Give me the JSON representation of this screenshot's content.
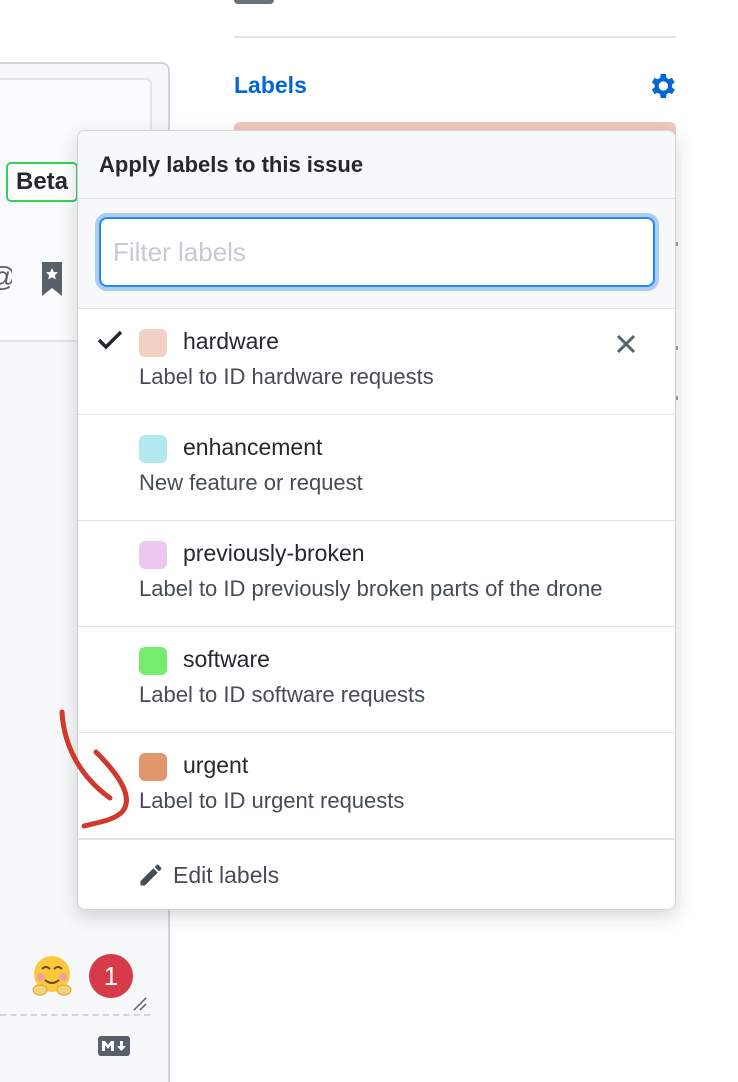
{
  "editor": {
    "beta_badge": "Beta",
    "notification_count": "1",
    "icons": [
      "mention-icon",
      "bookmark-icon",
      "hugging-face-emoji",
      "resize-handle-icon",
      "markdown-icon"
    ]
  },
  "sidebar": {
    "labels_heading": "Labels",
    "icons": [
      "gear-icon"
    ]
  },
  "dropdown": {
    "title": "Apply labels to this issue",
    "filter_placeholder": "Filter labels",
    "filter_value": "",
    "labels": [
      {
        "name": "hardware",
        "description": "Label to ID hardware requests",
        "color": "#f1d1c4",
        "selected": true
      },
      {
        "name": "enhancement",
        "description": "New feature or request",
        "color": "#b3e8ee",
        "selected": false
      },
      {
        "name": "previously-broken",
        "description": "Label to ID previously broken parts of the drone",
        "color": "#ecc8f1",
        "selected": false
      },
      {
        "name": "software",
        "description": "Label to ID software requests",
        "color": "#74ec6c",
        "selected": false
      },
      {
        "name": "urgent",
        "description": "Label to ID urgent requests",
        "color": "#e0976e",
        "selected": false
      }
    ],
    "edit_labels": "Edit labels",
    "icons": [
      "check-icon",
      "close-icon",
      "pencil-icon"
    ]
  },
  "colors": {
    "link_blue": "#0366d6",
    "focus_blue": "#2188ff",
    "badge_red": "#d73a49",
    "beta_green": "#34d058",
    "annotation_red": "#d0392b"
  }
}
